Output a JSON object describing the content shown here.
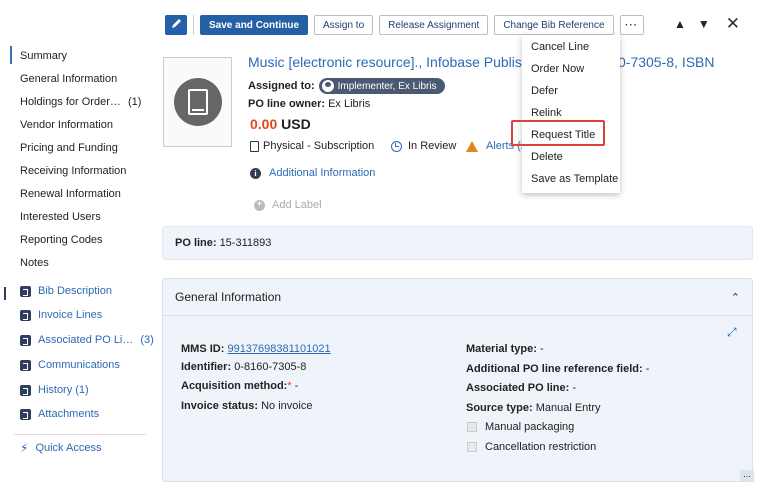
{
  "toolbar": {
    "edit_icon": "pencil-icon",
    "save_continue": "Save and Continue",
    "assign_to": "Assign to",
    "release_assignment": "Release Assignment",
    "change_bib_reference": "Change Bib Reference",
    "more": "···",
    "nav_up": "▲",
    "nav_down": "▼",
    "close": "✕"
  },
  "sidebar": {
    "items": [
      {
        "label": "Summary"
      },
      {
        "label": "General Information"
      },
      {
        "label": "Holdings for Order…",
        "count": "(1)"
      },
      {
        "label": "Vendor Information"
      },
      {
        "label": "Pricing and Funding"
      },
      {
        "label": "Receiving Information"
      },
      {
        "label": "Renewal Information"
      },
      {
        "label": "Interested Users"
      },
      {
        "label": "Reporting Codes"
      },
      {
        "label": "Notes"
      }
    ],
    "links": [
      {
        "label": "Bib Description"
      },
      {
        "label": "Invoice Lines"
      },
      {
        "label": "Associated PO Li…",
        "count": "(3)"
      },
      {
        "label": "Communications"
      },
      {
        "label": "History",
        "count": "(1)"
      },
      {
        "label": "Attachments"
      }
    ],
    "quick_access": "Quick Access"
  },
  "header": {
    "title": "Music [electronic resource]., Infobase Publishi",
    "title_tail": "0-7305-8, ISBN",
    "assigned_label": "Assigned to:",
    "assigned_value": "Implementer, Ex Libris",
    "owner_label": "PO line owner:",
    "owner_value": "Ex Libris",
    "price_amount": "0.00",
    "price_currency": "USD",
    "format": "Physical - Subscription",
    "status": "In Review",
    "alerts": "Alerts (2",
    "additional_info": "Additional Information",
    "add_label": "Add Label"
  },
  "poline": {
    "label": "PO line:",
    "value": "15-311893"
  },
  "general": {
    "title": "General Information",
    "mms_label": "MMS ID:",
    "mms_value": "99137698381101021",
    "identifier_label": "Identifier:",
    "identifier_value": "0-8160-7305-8",
    "acq_label": "Acquisition method:",
    "acq_req": "*",
    "acq_value": " -",
    "invoice_label": "Invoice status:",
    "invoice_value": "No invoice",
    "material_label": "Material type:",
    "material_value": " -",
    "addref_label": "Additional PO line reference field:",
    "addref_value": " -",
    "assoc_label": "Associated PO line:",
    "assoc_value": " -",
    "source_label": "Source type:",
    "source_value": "Manual Entry",
    "manual_packaging": "Manual packaging",
    "cancel_restriction": "Cancellation restriction"
  },
  "menu": {
    "items": [
      "Cancel Line",
      "Order Now",
      "Defer",
      "Relink",
      "Request Title",
      "Delete",
      "Save as Template"
    ],
    "highlight_color": "#e0403c"
  },
  "colors": {
    "primary": "#2560a6",
    "link": "#2c6ab3",
    "price": "#e04a1a",
    "panel_bg": "#eef4f9"
  }
}
